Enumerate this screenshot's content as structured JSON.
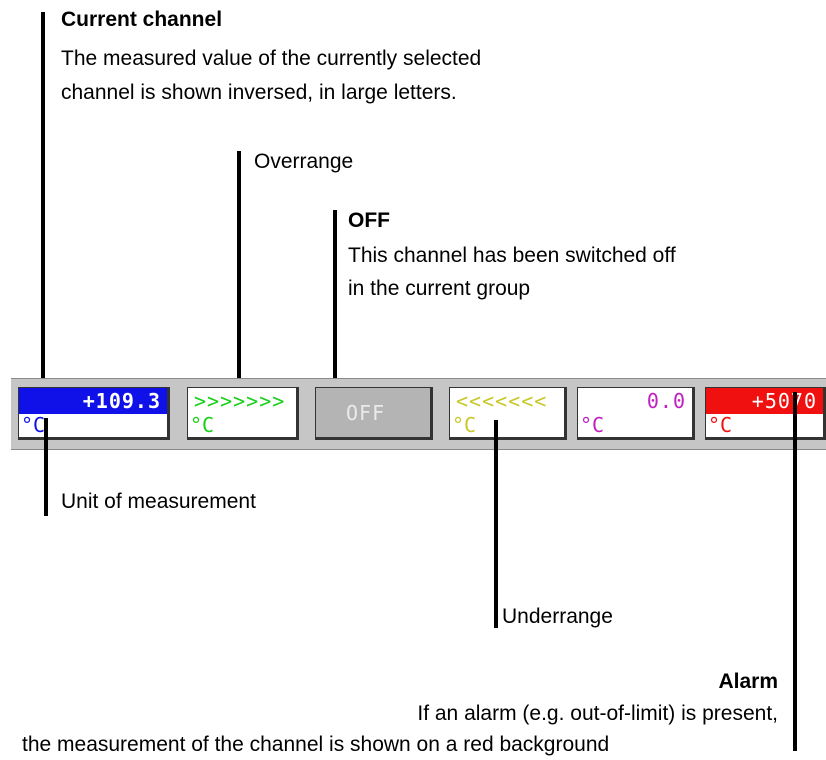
{
  "annotations": {
    "current_channel": {
      "title": "Current channel",
      "lines": [
        "The measured value of the currently selected",
        "channel is shown inversed, in large letters."
      ]
    },
    "overrange": {
      "title": "Overrange"
    },
    "off": {
      "title": "OFF",
      "lines": [
        "This channel has been switched off",
        "in the current group"
      ]
    },
    "unit": {
      "title": "Unit of measurement"
    },
    "underrange": {
      "title": "Underrange"
    },
    "alarm": {
      "title": "Alarm",
      "lines": [
        "If an alarm (e.g. out-of-limit) is present,",
        "the measurement of the channel is shown on a red background"
      ]
    }
  },
  "channels": [
    {
      "id": "current",
      "value": "+109.3",
      "unit": "°C",
      "color": "#1010e8"
    },
    {
      "id": "overrange",
      "value": ">>>>>>>",
      "unit": "°C",
      "color": "#18d018"
    },
    {
      "id": "off",
      "value": "OFF",
      "unit": "",
      "color": "#b4b4b4"
    },
    {
      "id": "underrange",
      "value": "<<<<<<<",
      "unit": "°C",
      "color": "#c8c82a"
    },
    {
      "id": "normal",
      "value": "0.0",
      "unit": "°C",
      "color": "#c020c0"
    },
    {
      "id": "alarm",
      "value": "+5070",
      "unit": "°C",
      "color": "#f01010"
    }
  ]
}
